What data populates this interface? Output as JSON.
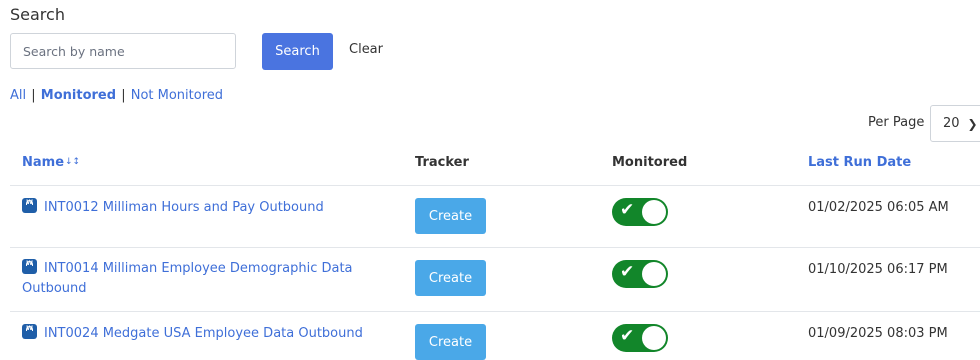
{
  "search": {
    "title": "Search",
    "placeholder": "Search by name",
    "search_label": "Search",
    "clear_label": "Clear"
  },
  "filters": {
    "all": "All",
    "monitored": "Monitored",
    "not_monitored": "Not Monitored",
    "separator": "|",
    "active": "monitored"
  },
  "pagination": {
    "per_page_label": "Per Page",
    "per_page_value": "20"
  },
  "table": {
    "columns": {
      "name": "Name",
      "tracker": "Tracker",
      "monitored": "Monitored",
      "last_run": "Last Run Date"
    },
    "rows": [
      {
        "name": "INT0012 Milliman Hours and Pay Outbound",
        "tracker_label": "Create",
        "monitored": true,
        "last_run": "01/02/2025 06:05 AM"
      },
      {
        "name": "INT0014 Milliman Employee Demographic Data Outbound",
        "tracker_label": "Create",
        "monitored": true,
        "last_run": "01/10/2025 06:17 PM"
      },
      {
        "name": "INT0024 Medgate USA Employee Data Outbound",
        "tracker_label": "Create",
        "monitored": true,
        "last_run": "01/09/2025 08:03 PM"
      }
    ]
  },
  "colors": {
    "primary": "#4a74e0",
    "link": "#3f6fd8",
    "create": "#4aa8e8",
    "toggle_on": "#12862a"
  },
  "icons": {
    "row_icon": "workday-app-icon",
    "sort": "sort-az-icon",
    "dropdown": "chevron-down-icon",
    "toggle_check": "check-icon"
  }
}
